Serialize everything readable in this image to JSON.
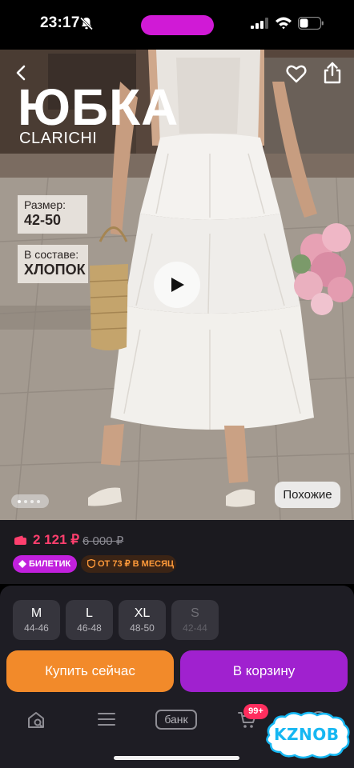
{
  "status_bar": {
    "time": "23:17",
    "icons": [
      "bell-slash-icon",
      "signal-icon",
      "wifi-icon",
      "battery-icon"
    ],
    "island_color": "#d01ad6"
  },
  "product": {
    "title": "ЮБКА",
    "brand": "CLARICHI",
    "size_label": "Размер:",
    "size_value": "42-50",
    "composition_label": "В составе:",
    "composition_value": "ХЛОПОК",
    "similar_label": "Похожие",
    "gallery_count": 4,
    "gallery_active_index": 0
  },
  "pricing": {
    "price": "2 121 ₽",
    "old_price": "6 000 ₽",
    "tag_ticket": "БИЛЕТИК",
    "tag_installment": "ОТ 73 ₽ В МЕСЯЦ",
    "price_color": "#ff3f6e"
  },
  "sizes": [
    {
      "size": "M",
      "range": "44-46",
      "available": true
    },
    {
      "size": "L",
      "range": "46-48",
      "available": true
    },
    {
      "size": "XL",
      "range": "48-50",
      "available": true
    },
    {
      "size": "S",
      "range": "42-44",
      "available": false
    }
  ],
  "actions": {
    "buy_now": "Купить сейчас",
    "add_to_cart": "В корзину",
    "buy_color": "#f28a2a",
    "cart_color": "#a021cf"
  },
  "tab_bar": {
    "items": [
      "home-search-icon",
      "menu-icon",
      "bank-icon",
      "cart-icon",
      "profile-icon"
    ],
    "bank_label": "банк",
    "cart_badge": "99+"
  },
  "watermark": "KZNOB"
}
